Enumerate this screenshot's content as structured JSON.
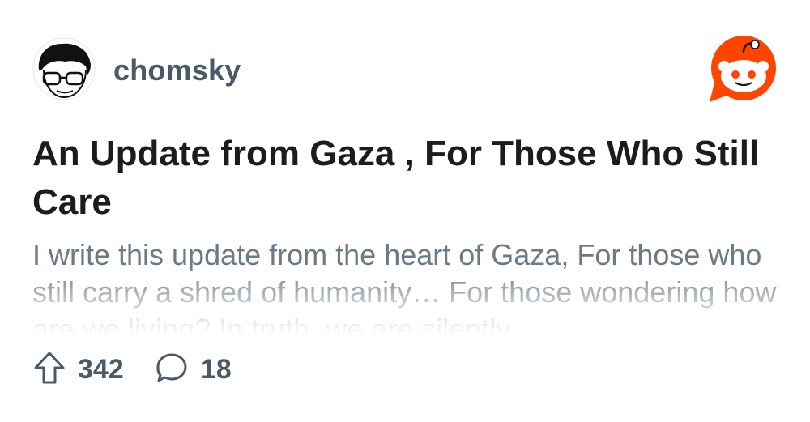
{
  "post": {
    "author": "chomsky",
    "title": "An Update from Gaza , For Those Who Still Care",
    "body": "I write this update from the heart of Gaza, For those who still carry a shred of humanity… For those wondering how are we living? In truth, we are silently",
    "upvotes": "342",
    "comments": "18"
  },
  "icons": {
    "avatar": "author-avatar",
    "logo": "reddit-logo-icon",
    "upvote": "upvote-arrow-icon",
    "comment": "comment-bubble-icon"
  },
  "colors": {
    "brand": "#ff4500",
    "author_text": "#4a5a68",
    "title_text": "#1c1c1c",
    "body_text": "#6b7a86"
  }
}
